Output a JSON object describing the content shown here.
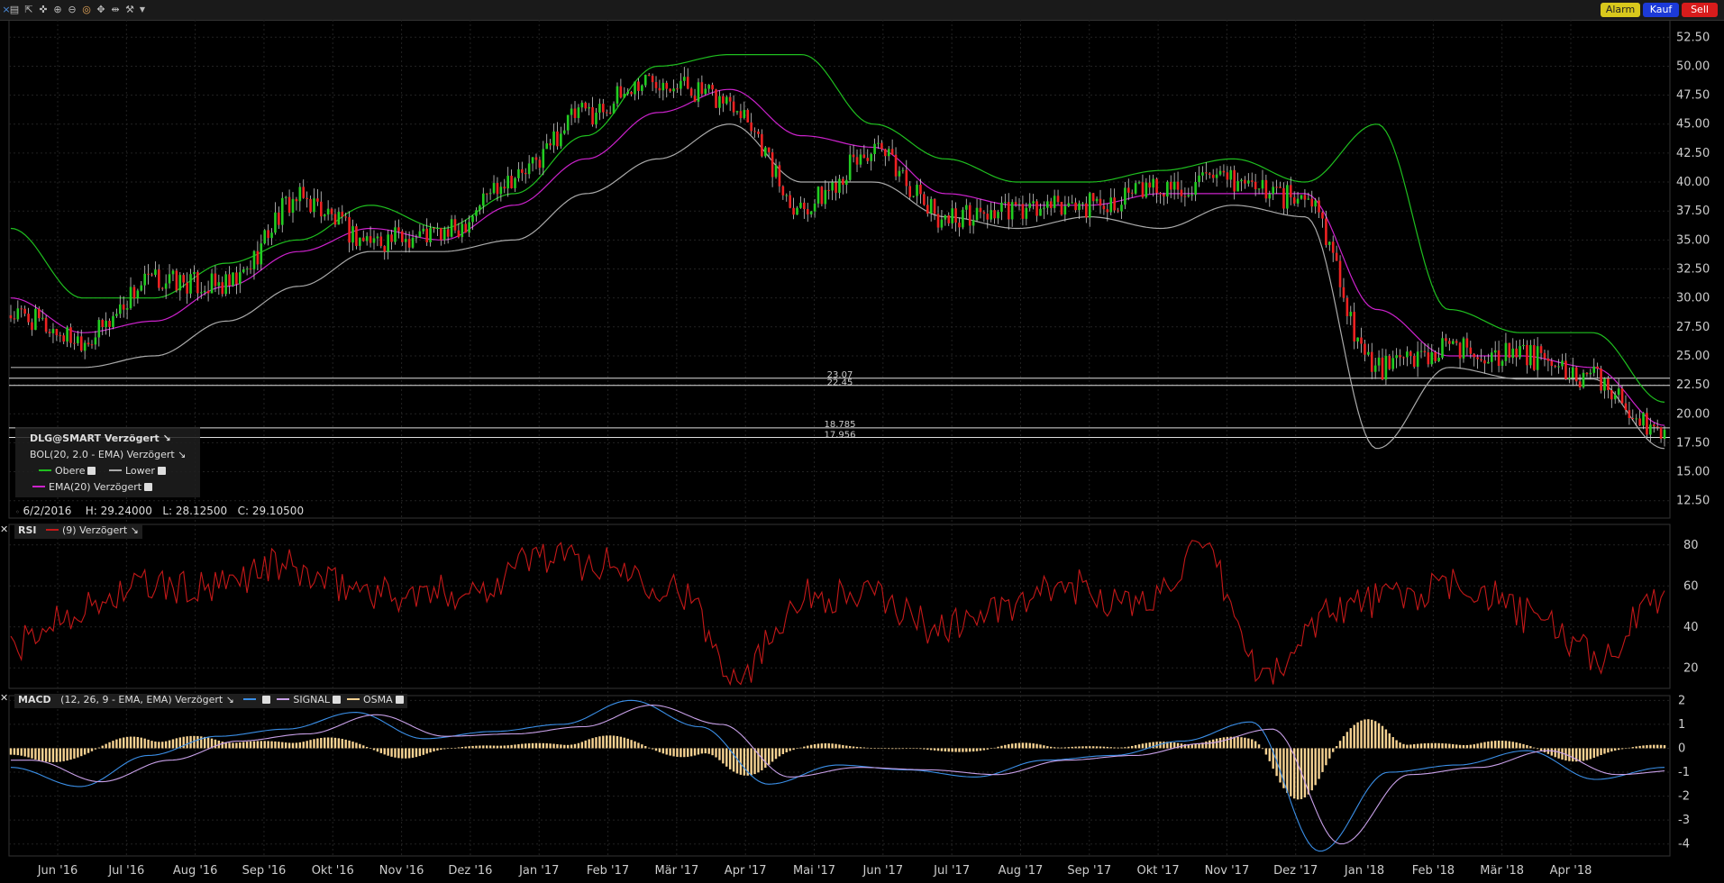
{
  "toolbar": {
    "icons": [
      "bar-chart-icon",
      "cursor-icon",
      "crosshair-icon",
      "zoom-in-icon",
      "zoom-out-icon",
      "target-icon",
      "pan-icon",
      "split-icon",
      "wrench-icon",
      "dropdown-icon"
    ],
    "alarm_label": "Alarm",
    "buy_label": "Kauf",
    "sell_label": "Sell"
  },
  "colors": {
    "up": "#22cc22",
    "down": "#ee2222",
    "upper_band": "#1fbf1f",
    "lower_band": "#aaaaaa",
    "ema": "#cc22cc",
    "rsi": "#c41818",
    "macd": "#3a8ee6",
    "signal": "#c8a0e8",
    "osma": "#f6d292",
    "grid": "#222222"
  },
  "price_panel": {
    "symbol_label": "DLG@SMART Verzögert",
    "bol_label": "BOL(20, 2.0 - EMA) Verzögert",
    "upper_label": "Obere",
    "lower_label": "Lower",
    "ema_label": "EMA(20) Verzögert",
    "info": {
      "date": "6/2/2016",
      "high": "H: 29.24000",
      "low": "L: 28.12500",
      "close": "C: 29.10500"
    },
    "hlines": [
      {
        "value": 23.07,
        "label": "23.07"
      },
      {
        "value": 22.45,
        "label": "22.45"
      },
      {
        "value": 18.785,
        "label": "18.785"
      },
      {
        "value": 17.956,
        "label": "17.956"
      }
    ]
  },
  "rsi_panel": {
    "title": "RSI",
    "params": "(9) Verzögert"
  },
  "macd_panel": {
    "title": "MACD",
    "params": "(12, 26, 9 - EMA, EMA) Verzögert",
    "signal_label": "SIGNAL",
    "osma_label": "OSMA"
  },
  "chart_data": [
    {
      "type": "candlestick",
      "title": "DLG@SMART",
      "x_ticks": [
        "Jun '16",
        "Jul '16",
        "Aug '16",
        "Sep '16",
        "Okt '16",
        "Nov '16",
        "Dez '16",
        "Jan '17",
        "Feb '17",
        "Mär '17",
        "Apr '17",
        "Mai '17",
        "Jun '17",
        "Jul '17",
        "Aug '17",
        "Sep '17",
        "Okt '17",
        "Nov '17",
        "Dez '17",
        "Jan '18",
        "Feb '18",
        "Mär '18",
        "Apr '18"
      ],
      "x": [
        "2016-06",
        "2016-07",
        "2016-08",
        "2016-09",
        "2016-10",
        "2016-11",
        "2016-12",
        "2017-01",
        "2017-02",
        "2017-03",
        "2017-04",
        "2017-05",
        "2017-06",
        "2017-07",
        "2017-08",
        "2017-09",
        "2017-10",
        "2017-11",
        "2017-12",
        "2018-01",
        "2018-02",
        "2018-03",
        "2018-04",
        "2018-05"
      ],
      "ylim": [
        11,
        54
      ],
      "y_ticks": [
        12.5,
        15,
        17.5,
        20,
        22.5,
        25,
        27.5,
        30,
        32.5,
        35,
        37.5,
        40,
        42.5,
        45,
        47.5,
        50,
        52.5
      ],
      "close": [
        28.5,
        26.5,
        31.5,
        31.0,
        38.5,
        35.0,
        35.5,
        40.5,
        46.0,
        49.0,
        47.0,
        38.0,
        42.5,
        37.0,
        37.5,
        38.0,
        39.5,
        40.0,
        38.5,
        24.0,
        25.5,
        25.0,
        23.0,
        18.0
      ],
      "series": [
        {
          "name": "Obere",
          "values": [
            36,
            30,
            30,
            33,
            35,
            38,
            36,
            39,
            44,
            50,
            51,
            51,
            45,
            42,
            40,
            40,
            41,
            42,
            40,
            45,
            29,
            27,
            27,
            21
          ]
        },
        {
          "name": "Lower",
          "values": [
            24,
            24,
            25,
            28,
            31,
            34,
            34,
            35,
            39,
            42,
            45,
            40,
            40,
            37,
            36,
            37,
            36,
            38,
            37,
            17,
            24,
            23,
            23,
            17
          ]
        },
        {
          "name": "EMA(20)",
          "values": [
            30,
            27,
            28,
            31,
            34,
            36,
            35,
            38,
            42,
            46,
            48,
            44,
            43,
            39,
            38,
            38,
            39,
            39,
            39,
            29,
            25,
            25,
            24,
            19
          ]
        }
      ]
    },
    {
      "type": "line",
      "title": "RSI",
      "ylim": [
        10,
        90
      ],
      "y_ticks": [
        20,
        40,
        60,
        80
      ],
      "series": [
        {
          "name": "(9) Verzögert",
          "values": [
            30,
            48,
            60,
            58,
            70,
            60,
            55,
            58,
            75,
            70,
            60,
            18,
            55,
            55,
            40,
            48,
            60,
            50,
            75,
            15,
            50,
            55,
            60,
            45,
            25,
            55
          ]
        }
      ]
    },
    {
      "type": "bar",
      "title": "MACD",
      "ylim": [
        -4.5,
        2.2
      ],
      "y_ticks": [
        2,
        1,
        0,
        -1,
        -2,
        -3,
        -4
      ],
      "series": [
        {
          "name": "MACD",
          "values": [
            -0.8,
            -1.6,
            -0.3,
            0.5,
            0.8,
            1.5,
            0.4,
            0.7,
            1.0,
            2.0,
            0.9,
            -1.5,
            -0.7,
            -0.9,
            -1.2,
            -0.5,
            -0.3,
            0.3,
            1.1,
            -4.3,
            -1.0,
            -0.7,
            -0.1,
            -1.3,
            -0.8
          ]
        },
        {
          "name": "SIGNAL",
          "values": [
            -0.5,
            -1.4,
            -0.5,
            0.3,
            0.6,
            1.4,
            0.5,
            0.6,
            0.9,
            1.8,
            1.0,
            -1.2,
            -0.8,
            -0.9,
            -1.1,
            -0.5,
            -0.3,
            0.2,
            0.8,
            -4.0,
            -1.1,
            -0.8,
            -0.1,
            -1.1,
            -0.9
          ]
        },
        {
          "name": "OSMA",
          "values": [
            -0.3,
            -0.2,
            0.2,
            0.2,
            0.2,
            0.1,
            -0.1,
            0.1,
            0.1,
            0.2,
            -0.1,
            -0.3,
            0.1,
            0.0,
            -0.1,
            0.0,
            0.0,
            0.1,
            0.3,
            -0.3,
            0.1,
            0.1,
            0.0,
            -0.2,
            0.1
          ]
        }
      ]
    }
  ]
}
